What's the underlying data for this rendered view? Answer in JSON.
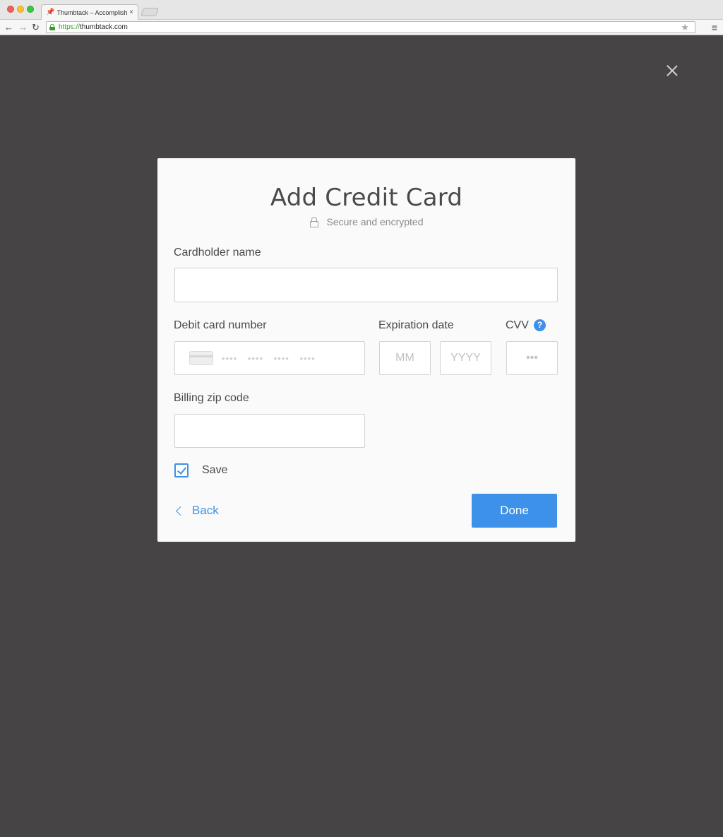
{
  "browser": {
    "tab_title": "Thumbtack – Accomplish",
    "tab_close": "×",
    "url_scheme": "https://",
    "url_host": "thumbtack.com"
  },
  "overlay": {
    "close_icon": "close-icon"
  },
  "modal": {
    "title": "Add Credit Card",
    "secure_text": "Secure and encrypted",
    "cardholder": {
      "label": "Cardholder name",
      "value": "",
      "placeholder": ""
    },
    "card_number": {
      "label": "Debit card number",
      "placeholder": "•••• •••• •••• ••••"
    },
    "expiration": {
      "label": "Expiration date",
      "month_placeholder": "MM",
      "year_placeholder": "YYYY"
    },
    "cvv": {
      "label": "CVV",
      "placeholder": "•••",
      "help": "?"
    },
    "zip": {
      "label": "Billing zip code",
      "value": "",
      "placeholder": ""
    },
    "save": {
      "label": "Save",
      "checked": true
    },
    "back_label": "Back",
    "done_label": "Done"
  },
  "colors": {
    "accent": "#3e91e8",
    "overlay_bg": "#464445",
    "modal_bg": "#fafafa"
  }
}
